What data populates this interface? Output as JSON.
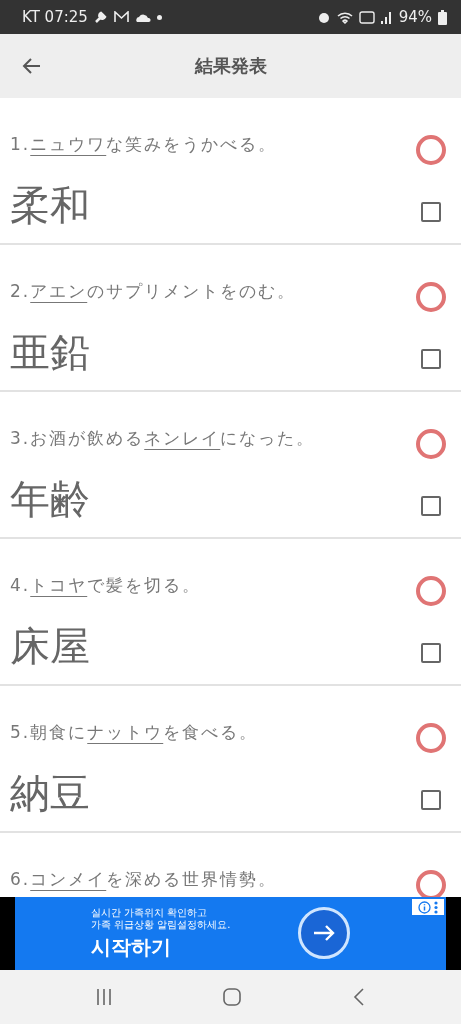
{
  "status_bar": {
    "carrier_time": "KT 07:25",
    "battery": "94%"
  },
  "header": {
    "title": "結果発表"
  },
  "questions": [
    {
      "number": "1.",
      "blank": "ニュウワ",
      "rest": "な笑みをうかべる。",
      "answer": "柔和",
      "correct": true,
      "checked": false
    },
    {
      "number": "2.",
      "blank": "アエン",
      "rest": "のサプリメントをのむ。",
      "answer": "亜鉛",
      "correct": true,
      "checked": false
    },
    {
      "number": "3.",
      "before": "お酒が飲める",
      "blank": "ネンレイ",
      "rest": "になった。",
      "answer": "年齢",
      "correct": true,
      "checked": false
    },
    {
      "number": "4.",
      "blank": "トコヤ",
      "rest": "で髪を切る。",
      "answer": "床屋",
      "correct": true,
      "checked": false
    },
    {
      "number": "5.",
      "before": "朝食に",
      "blank": "ナットウ",
      "rest": "を食べる。",
      "answer": "納豆",
      "correct": true,
      "checked": false
    },
    {
      "number": "6.",
      "blank": "コンメイ",
      "rest": "を深める世界情勢。",
      "correct": true
    }
  ],
  "ad": {
    "line_1": "실시간 가족위치 확인하고",
    "line_2": "가족 위급상황 알림설정하세요.",
    "cta": "시작하기"
  }
}
